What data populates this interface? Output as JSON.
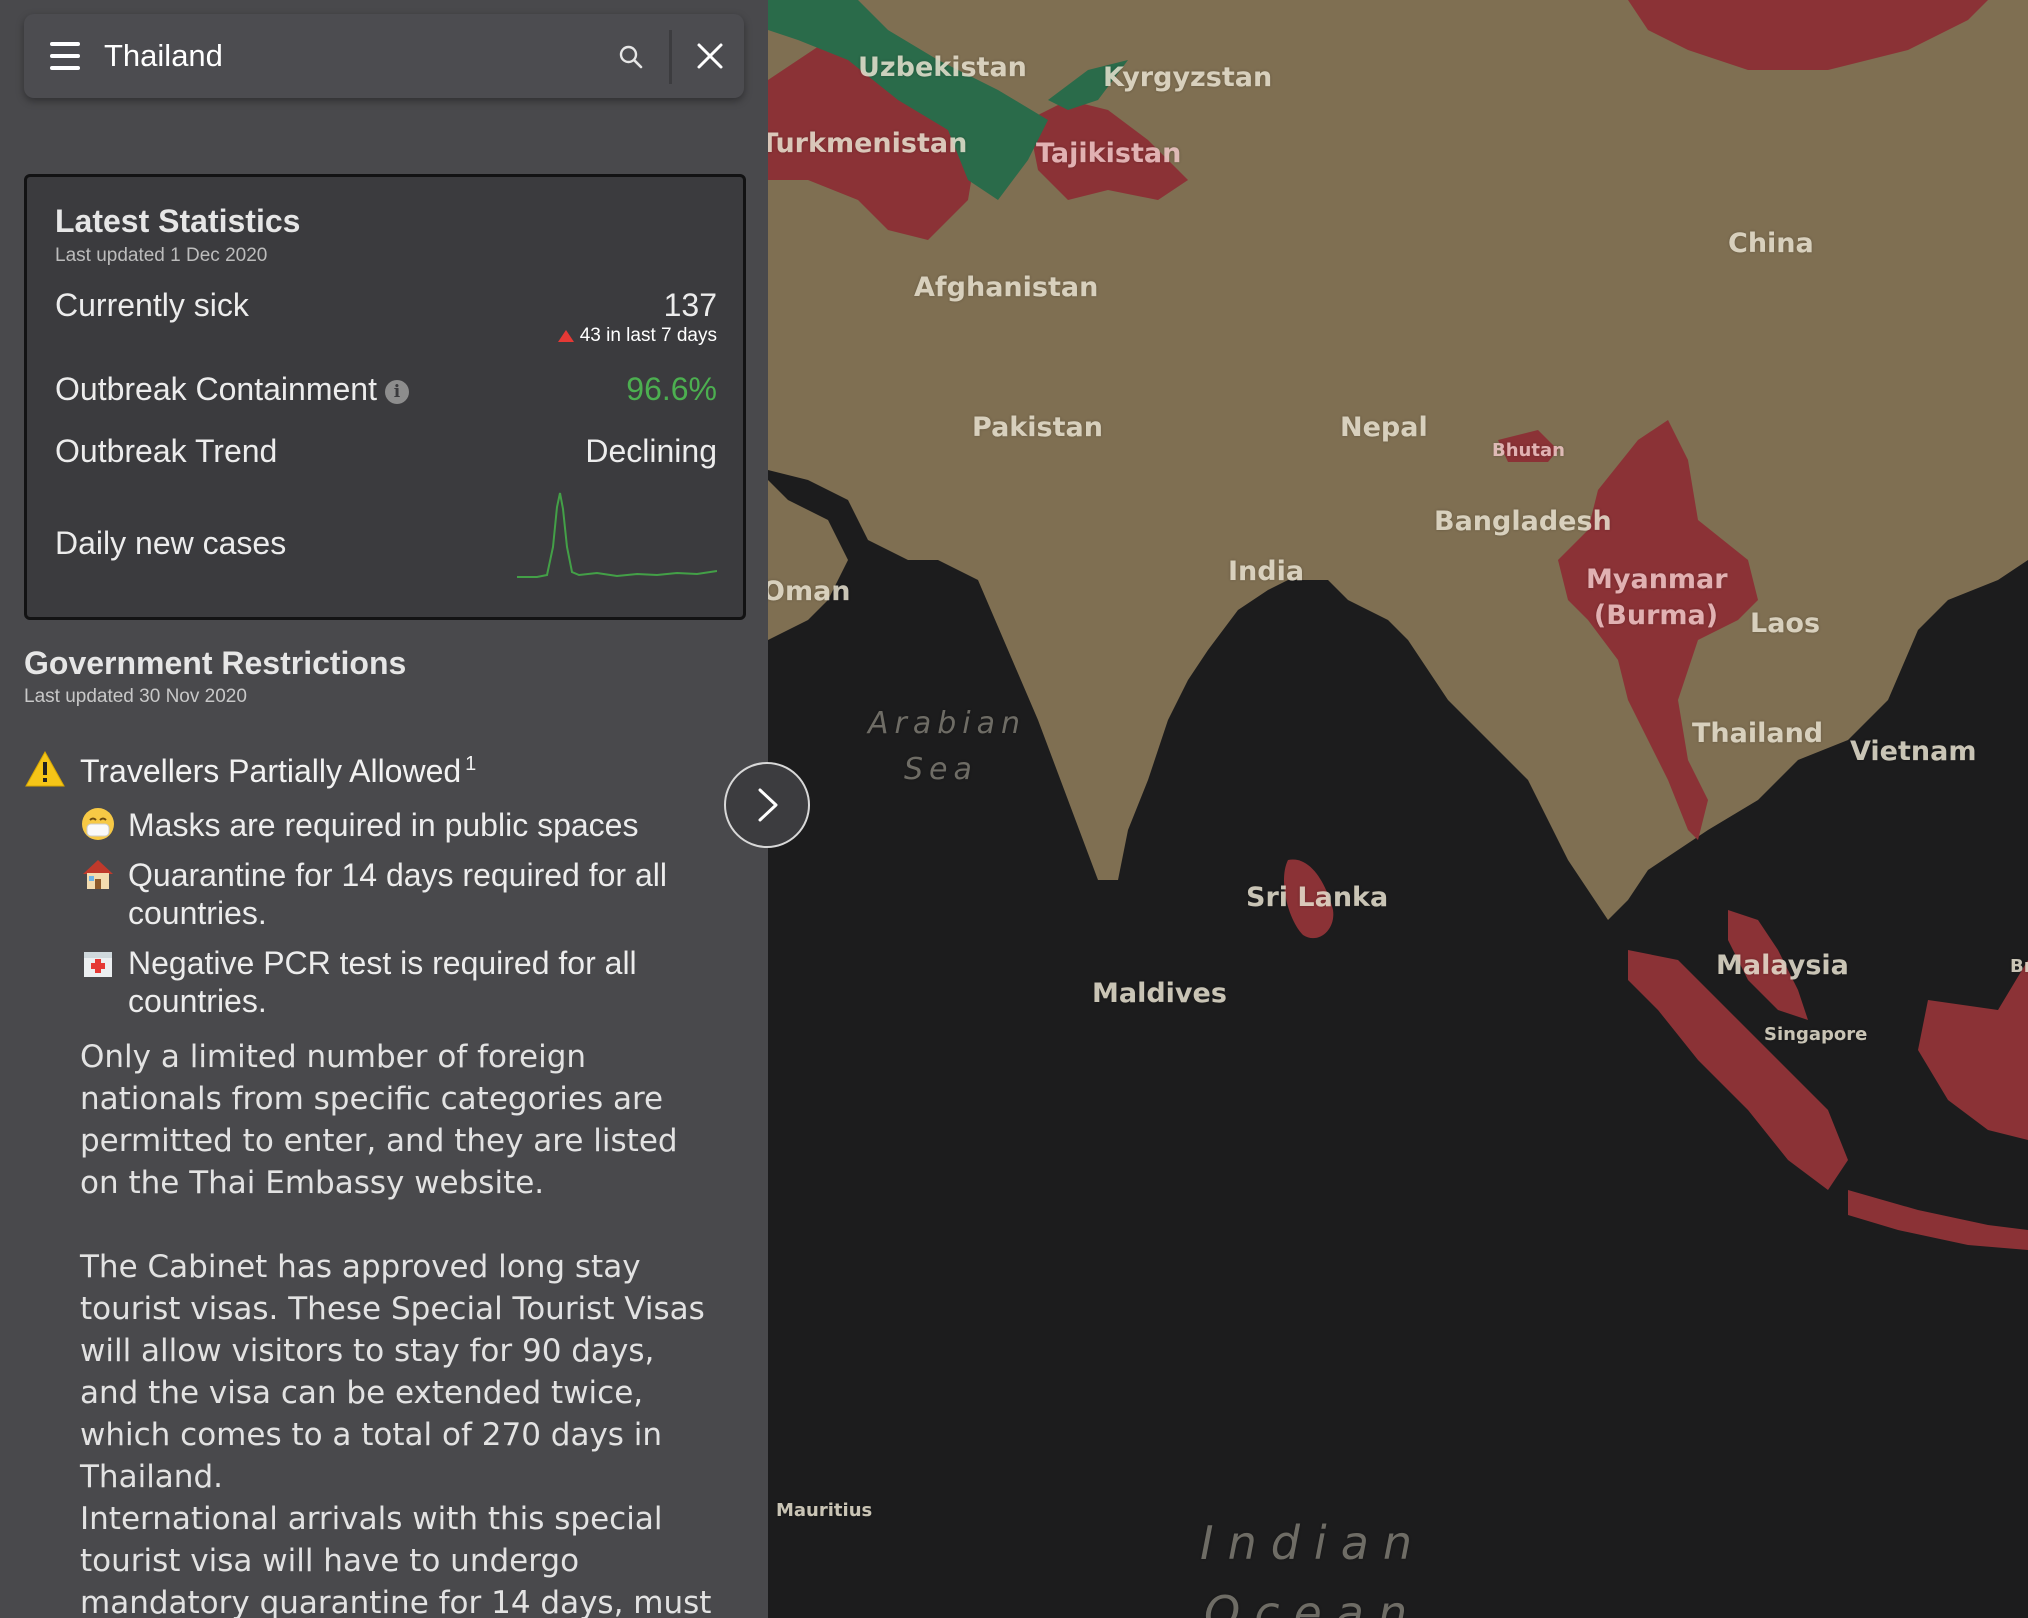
{
  "search": {
    "value": "Thailand",
    "placeholder": "Search"
  },
  "stats": {
    "title": "Latest Statistics",
    "updated": "Last updated 1 Dec 2020",
    "currently_sick_label": "Currently sick",
    "currently_sick_value": "137",
    "change_text": "43 in last 7 days",
    "containment_label": "Outbreak Containment",
    "containment_value": "96.6%",
    "trend_label": "Outbreak Trend",
    "trend_value": "Declining",
    "daily_label": "Daily new cases",
    "colors": {
      "containment": "#4caf50",
      "trend_up": "#e53935",
      "sparkline": "#43a047"
    }
  },
  "restrictions": {
    "title": "Government Restrictions",
    "updated": "Last updated 30 Nov 2020",
    "status": "Travellers Partially Allowed",
    "status_footnote": "1",
    "rules": [
      {
        "icon": "mask-icon",
        "text": "Masks are required in public spaces"
      },
      {
        "icon": "house-icon",
        "text": "Quarantine for 14 days required for all countries."
      },
      {
        "icon": "hospital-icon",
        "text": "Negative PCR test is required for all countries."
      }
    ],
    "paragraphs": [
      "Only a limited number of foreign nationals from specific categories are permitted to enter, and they are listed on the Thai Embassy website.",
      "The Cabinet has approved long stay tourist visas. These Special Tourist Visas will allow visitors to stay for 90 days, and the visa can be extended twice, which comes to a total of 270 days in Thailand.",
      "International arrivals with this special tourist visa will have to undergo mandatory quarantine for 14 days, must"
    ]
  },
  "map": {
    "labels": {
      "uzbekistan": "Uzbekistan",
      "kyrgyzstan": "Kyrgyzstan",
      "turkmenistan": "Turkmenistan",
      "tajikistan": "Tajikistan",
      "china": "China",
      "afghanistan": "Afghanistan",
      "pakistan": "Pakistan",
      "nepal": "Nepal",
      "bhutan": "Bhutan",
      "bangladesh": "Bangladesh",
      "india": "India",
      "oman": "Oman",
      "myanmar": "Myanmar (Burma)",
      "laos": "Laos",
      "thailand": "Thailand",
      "vietnam": "Vietnam",
      "arabian_sea_1": "Arabian",
      "arabian_sea_2": "Sea",
      "sri_lanka": "Sri Lanka",
      "maldives": "Maldives",
      "malaysia": "Malaysia",
      "singapore": "Singapore",
      "brunei": "Br",
      "mauritius": "Mauritius",
      "indian_ocean_1": "Indian",
      "indian_ocean_2": "Ocean"
    },
    "colors": {
      "land": "#7f6f52",
      "water": "#1c1c1d",
      "restricted": "#8b3236",
      "open": "#2a6b4a"
    }
  }
}
